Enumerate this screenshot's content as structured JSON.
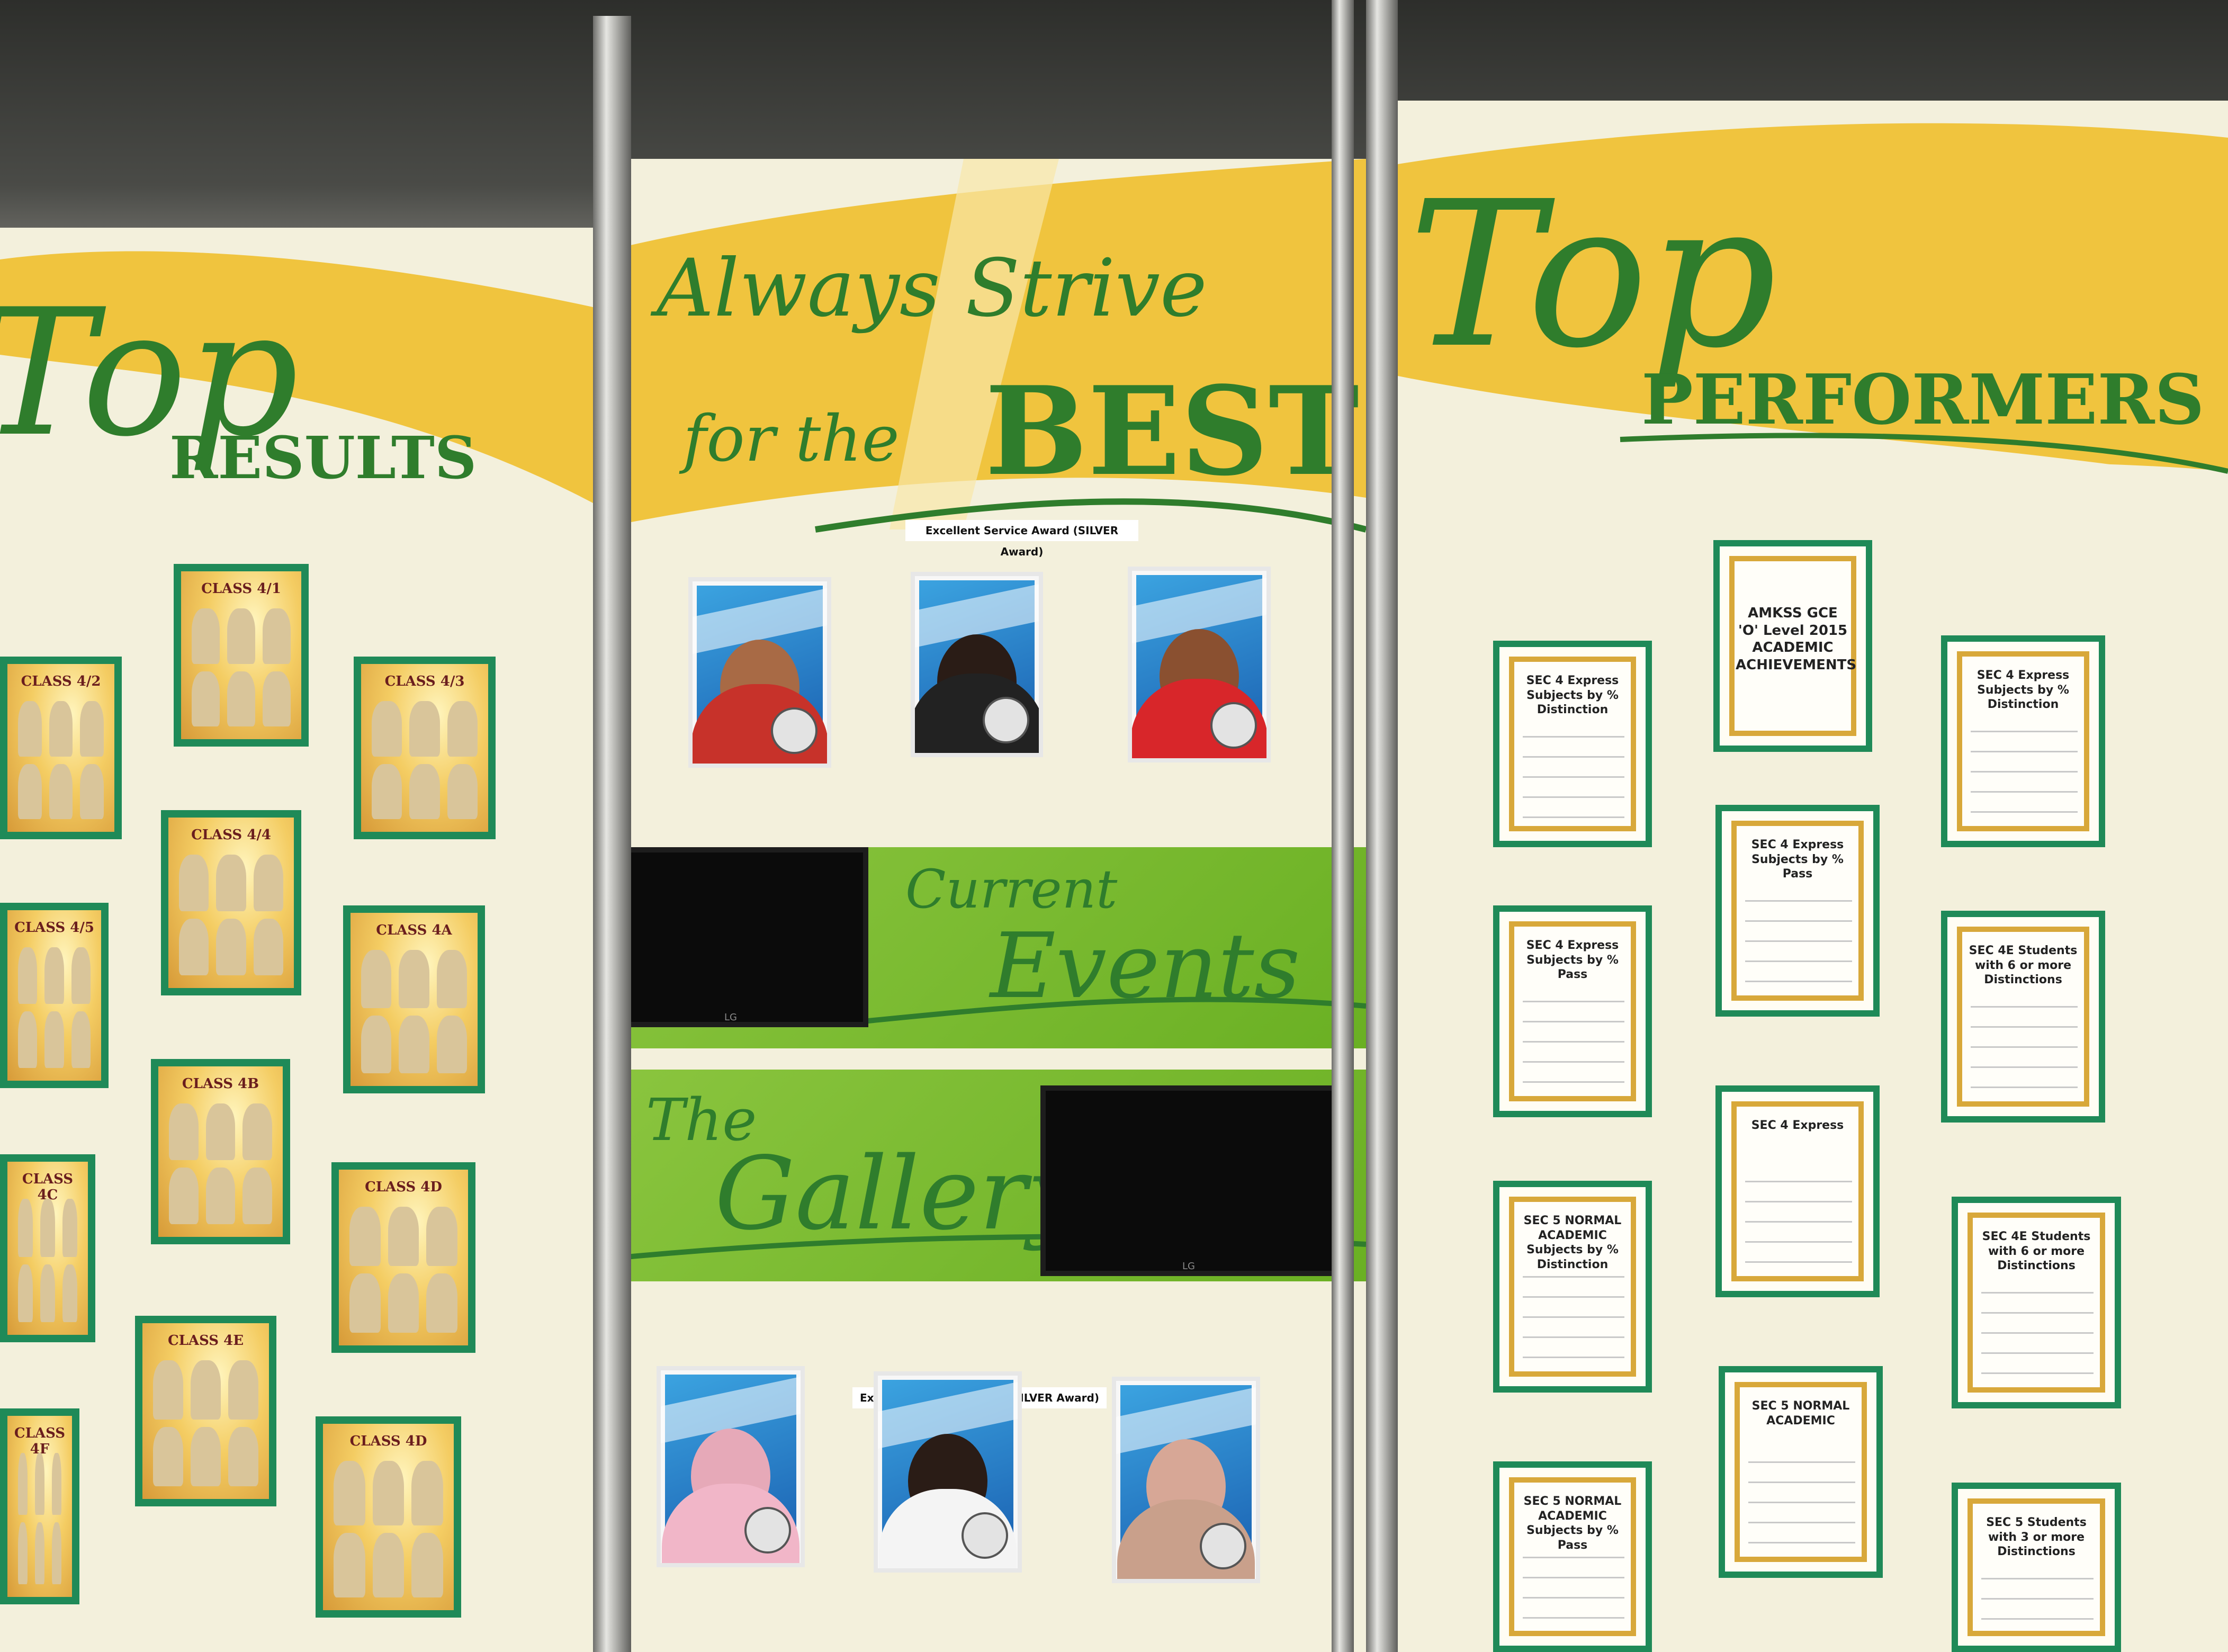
{
  "headings": {
    "left_big": "Top",
    "left_sub": "RESULTS",
    "center_line1": "Always Strive",
    "center_line2a": "for the",
    "center_line2b": "BEST",
    "right_big": "Top",
    "right_sub": "PERFORMERS"
  },
  "center": {
    "award_label_top": "Excellent Service Award (SILVER Award)",
    "award_label_bottom": "Excellent Service Award (SILVER Award)",
    "current_events_1": "Current",
    "current_events_2": "Events",
    "gallery_1": "The",
    "gallery_2": "Gallery",
    "tv_brand": "LG"
  },
  "left_posters": [
    "CLASS 4/1",
    "CLASS 4/2",
    "CLASS 4/3",
    "CLASS 4/4",
    "CLASS 4/5",
    "CLASS 4A",
    "CLASS 4B",
    "CLASS 4C",
    "CLASS 4D",
    "CLASS 4E",
    "CLASS 4F",
    "CLASS 4D"
  ],
  "right_certificates": {
    "main": "AMKSS GCE 'O' Level 2015 ACADEMIC ACHIEVEMENTS",
    "c1": "SEC 4 Express Subjects by % Distinction",
    "c2": "SEC 4 Express Subjects by % Distinction",
    "c3": "SEC 4 Express Subjects by % Pass",
    "c4": "SEC 4 Express Subjects by % Pass",
    "c5": "SEC 4E Students with 6 or more Distinctions",
    "c6": "SEC 4 Express",
    "c7": "SEC 5 NORMAL ACADEMIC Subjects by % Distinction",
    "c8": "SEC 4E Students with 6 or more Distinctions",
    "c9": "SEC 5 NORMAL ACADEMIC",
    "c10": "SEC 5 NORMAL ACADEMIC Subjects by % Pass",
    "c11": "SEC 5 Students with 3 or more Distinctions"
  },
  "colors": {
    "brand_green": "#2f7d2c",
    "banner_yellow": "#f0c43e",
    "board_cream": "#f3f0dc",
    "lime": "#7cbc34"
  }
}
